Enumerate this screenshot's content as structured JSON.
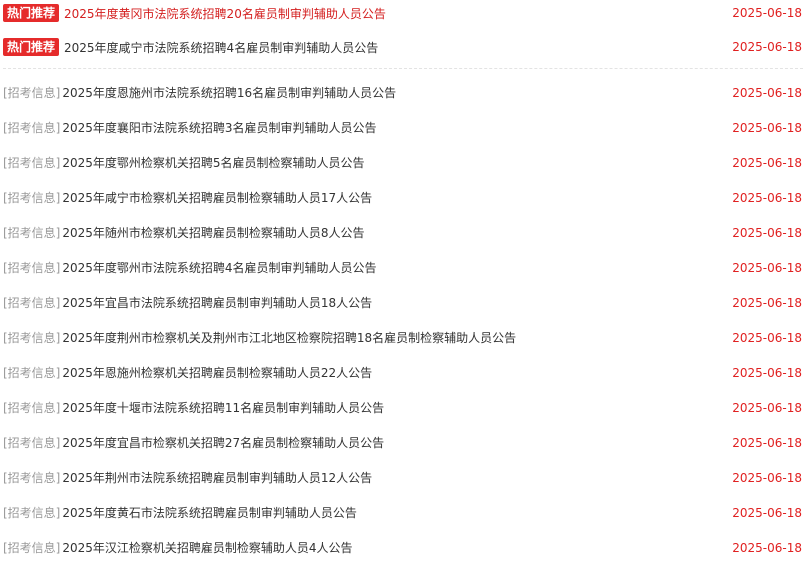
{
  "hot_items": [
    {
      "badge": "热门推荐",
      "title": "2025年度黄冈市法院系统招聘20名雇员制审判辅助人员公告",
      "date": "2025-06-18",
      "highlight": true
    },
    {
      "badge": "热门推荐",
      "title": "2025年度咸宁市法院系统招聘4名雇员制审判辅助人员公告",
      "date": "2025-06-18",
      "highlight": false
    }
  ],
  "items": [
    {
      "tag": "[招考信息]",
      "title": "2025年度恩施州市法院系统招聘16名雇员制审判辅助人员公告",
      "date": "2025-06-18"
    },
    {
      "tag": "[招考信息]",
      "title": "2025年度襄阳市法院系统招聘3名雇员制审判辅助人员公告",
      "date": "2025-06-18"
    },
    {
      "tag": "[招考信息]",
      "title": "2025年度鄂州检察机关招聘5名雇员制检察辅助人员公告",
      "date": "2025-06-18"
    },
    {
      "tag": "[招考信息]",
      "title": "2025年咸宁市检察机关招聘雇员制检察辅助人员17人公告",
      "date": "2025-06-18"
    },
    {
      "tag": "[招考信息]",
      "title": "2025年随州市检察机关招聘雇员制检察辅助人员8人公告",
      "date": "2025-06-18"
    },
    {
      "tag": "[招考信息]",
      "title": "2025年度鄂州市法院系统招聘4名雇员制审判辅助人员公告",
      "date": "2025-06-18"
    },
    {
      "tag": "[招考信息]",
      "title": "2025年宜昌市法院系统招聘雇员制审判辅助人员18人公告",
      "date": "2025-06-18"
    },
    {
      "tag": "[招考信息]",
      "title": "2025年度荆州市检察机关及荆州市江北地区检察院招聘18名雇员制检察辅助人员公告",
      "date": "2025-06-18"
    },
    {
      "tag": "[招考信息]",
      "title": "2025年恩施州检察机关招聘雇员制检察辅助人员22人公告",
      "date": "2025-06-18"
    },
    {
      "tag": "[招考信息]",
      "title": "2025年度十堰市法院系统招聘11名雇员制审判辅助人员公告",
      "date": "2025-06-18"
    },
    {
      "tag": "[招考信息]",
      "title": "2025年度宜昌市检察机关招聘27名雇员制检察辅助人员公告",
      "date": "2025-06-18"
    },
    {
      "tag": "[招考信息]",
      "title": "2025年荆州市法院系统招聘雇员制审判辅助人员12人公告",
      "date": "2025-06-18"
    },
    {
      "tag": "[招考信息]",
      "title": "2025年度黄石市法院系统招聘雇员制审判辅助人员公告",
      "date": "2025-06-18"
    },
    {
      "tag": "[招考信息]",
      "title": "2025年汉江检察机关招聘雇员制检察辅助人员4人公告",
      "date": "2025-06-18"
    }
  ],
  "colors": {
    "badge_bg": "#e52b2b",
    "date": "#e02020",
    "tag": "#999999",
    "title": "#333333",
    "title_highlight": "#d42020"
  }
}
